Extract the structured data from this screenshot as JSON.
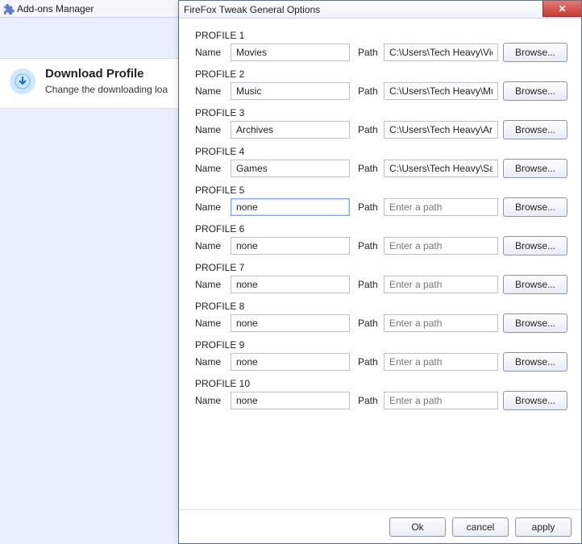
{
  "background": {
    "tab_label": "Add-ons Manager",
    "addon_title": "Download Profile",
    "addon_subtitle": "Change the downloading loa"
  },
  "dialog": {
    "title": "FireFox Tweak General Options",
    "labels": {
      "name": "Name",
      "path": "Path",
      "browse": "Browse...",
      "ok": "Ok",
      "cancel": "cancel",
      "apply": "apply",
      "path_placeholder": "Enter a path"
    },
    "active_profile_index": 4,
    "profiles": [
      {
        "heading": "PROFILE 1",
        "name": "Movies",
        "path": "C:\\Users\\Tech Heavy\\Vide"
      },
      {
        "heading": "PROFILE 2",
        "name": "Music",
        "path": "C:\\Users\\Tech Heavy\\Mus"
      },
      {
        "heading": "PROFILE 3",
        "name": "Archives",
        "path": "C:\\Users\\Tech Heavy\\Arch"
      },
      {
        "heading": "PROFILE 4",
        "name": "Games",
        "path": "C:\\Users\\Tech Heavy\\Save"
      },
      {
        "heading": "PROFILE 5",
        "name": "none",
        "path": ""
      },
      {
        "heading": "PROFILE 6",
        "name": "none",
        "path": ""
      },
      {
        "heading": "PROFILE 7",
        "name": "none",
        "path": ""
      },
      {
        "heading": "PROFILE 8",
        "name": "none",
        "path": ""
      },
      {
        "heading": "PROFILE 9",
        "name": "none",
        "path": ""
      },
      {
        "heading": "PROFILE 10",
        "name": "none",
        "path": ""
      }
    ]
  }
}
